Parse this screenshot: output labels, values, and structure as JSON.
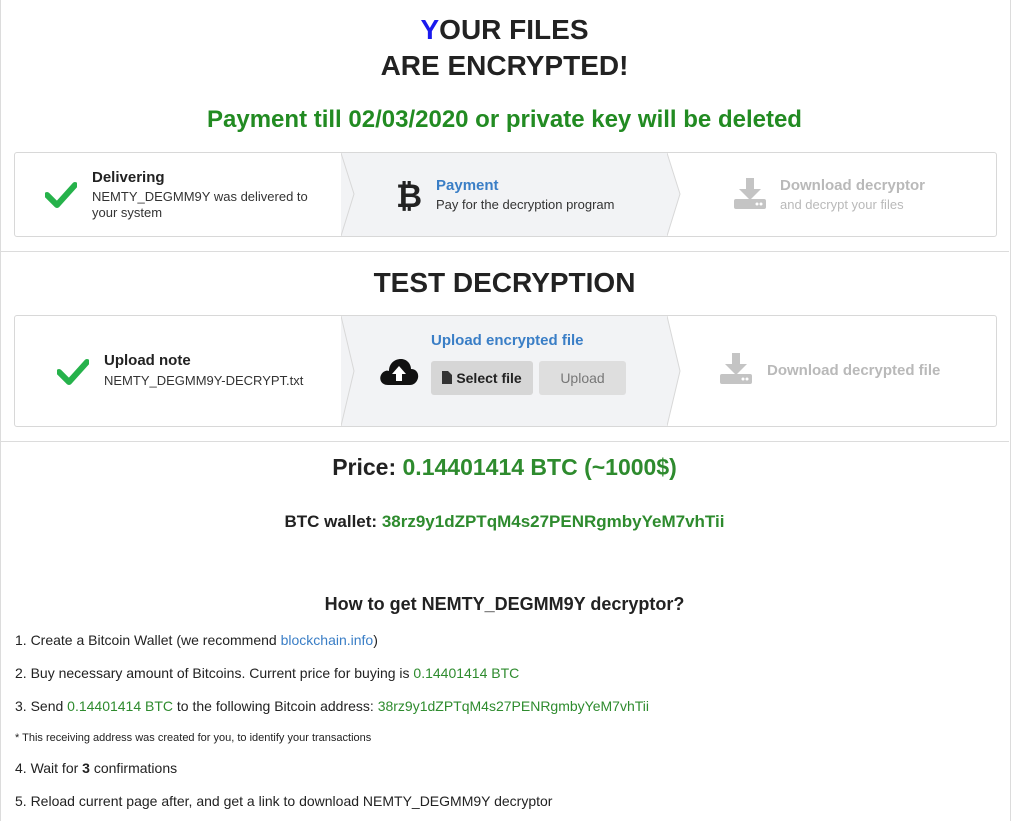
{
  "header": {
    "title_first_letter": "Y",
    "title_line1_rest": "OUR FILES",
    "title_line2": "ARE ENCRYPTED!",
    "deadline": "Payment till 02/03/2020 or private key will be deleted"
  },
  "payment_steps": [
    {
      "title": "Delivering",
      "desc": "NEMTY_DEGMM9Y was delivered to your system",
      "icon": "check-icon"
    },
    {
      "title": "Payment",
      "desc": "Pay for the decryption program",
      "icon": "bitcoin-icon"
    },
    {
      "title": "Download decryptor",
      "desc": "and decrypt your files",
      "icon": "download-icon"
    }
  ],
  "test_section": {
    "heading": "TEST DECRYPTION",
    "steps": [
      {
        "title": "Upload note",
        "desc": "NEMTY_DEGMM9Y-DECRYPT.txt",
        "icon": "check-icon"
      },
      {
        "title": "Upload encrypted file",
        "select_label": "Select file",
        "upload_label": "Upload",
        "icon": "cloud-upload-icon"
      },
      {
        "title": "Download decrypted file",
        "icon": "download-icon"
      }
    ]
  },
  "price": {
    "label": "Price:",
    "value": "0.14401414 BTC (~1000$)"
  },
  "wallet": {
    "label": "BTC wallet:",
    "address": "38rz9y1dZPTqM4s27PENRgmbyYeM7vhTii"
  },
  "instructions": {
    "heading": "How to get NEMTY_DEGMM9Y decryptor?",
    "step1_text": "1. Create a Bitcoin Wallet (we recommend ",
    "step1_link": "blockchain.info",
    "step1_end": ")",
    "step2_text": "2. Buy necessary amount of Bitcoins. Current price for buying is ",
    "step2_value": "0.14401414 BTC",
    "step3_text": "3. Send ",
    "step3_value": "0.14401414 BTC",
    "step3_mid": " to the following Bitcoin address: ",
    "step3_address": "38rz9y1dZPTqM4s27PENRgmbyYeM7vhTii",
    "note": "* This receiving address was created for you, to identify your transactions",
    "step4_text": "4. Wait for ",
    "step4_count": "3",
    "step4_end": " confirmations",
    "step5_text": "5. Reload current page after, and get a link to download NEMTY_DEGMM9Y decryptor"
  },
  "colors": {
    "green": "#2e8b2e",
    "blue_link": "#3a7ec6",
    "title_accent": "#1a1aee"
  }
}
